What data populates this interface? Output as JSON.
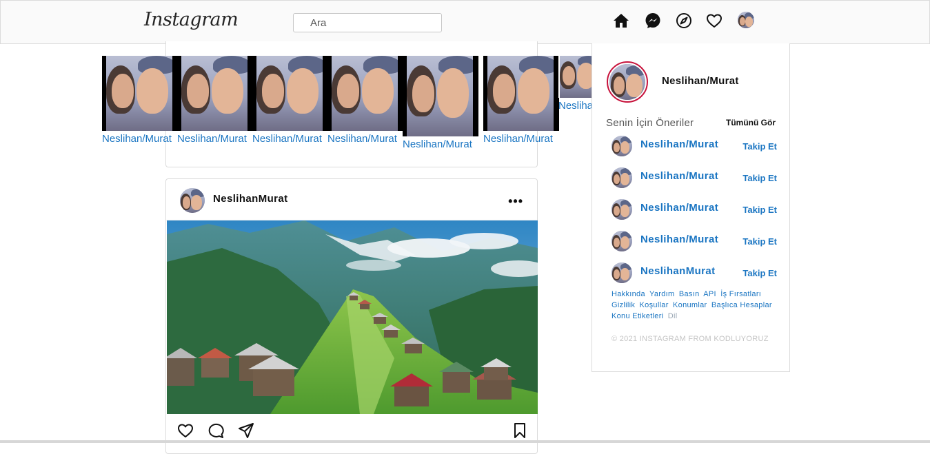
{
  "header": {
    "logo": "Instagram",
    "search_placeholder": "Ara",
    "icons": [
      "home-icon",
      "messenger-icon",
      "explore-icon",
      "heart-icon",
      "profile-avatar"
    ]
  },
  "stories": [
    {
      "name": "Neslihan/Murat"
    },
    {
      "name": "Neslihan/Murat"
    },
    {
      "name": "Neslihan/Murat"
    },
    {
      "name": "Neslihan/Murat"
    },
    {
      "name": "Neslihan/Murat"
    },
    {
      "name": "Neslihan/Murat"
    },
    {
      "name": "Neslihan/Murat"
    }
  ],
  "post": {
    "username": "NeslihanMurat",
    "more": "•••",
    "image": "mountain-village-landscape"
  },
  "sidebar": {
    "profile_name": "Neslihan/Murat",
    "suggestions_title": "Senin İçin Öneriler",
    "see_all": "Tümünü Gör",
    "suggestions": [
      {
        "name": "Neslihan/Murat",
        "follow": "Takip Et"
      },
      {
        "name": "Neslihan/Murat",
        "follow": "Takip Et"
      },
      {
        "name": "Neslihan/Murat",
        "follow": "Takip Et"
      },
      {
        "name": "Neslihan/Murat",
        "follow": "Takip Et"
      },
      {
        "name": "NeslihanMurat",
        "follow": "Takip Et"
      }
    ],
    "footer_links": [
      "Hakkında",
      "Yardım",
      "Basın",
      "API",
      "İş Fırsatları",
      "Gizlilik",
      "Koşullar",
      "Konumlar",
      "Başlıca Hesaplar",
      "Konu Etiketleri"
    ],
    "footer_lang": "Dil",
    "copyright": "© 2021 INSTAGRAM FROM KODLUYORUZ"
  },
  "colors": {
    "link_blue": "#1a75c2",
    "border": "#dbdbdb",
    "story_ring": "#c7123b"
  }
}
